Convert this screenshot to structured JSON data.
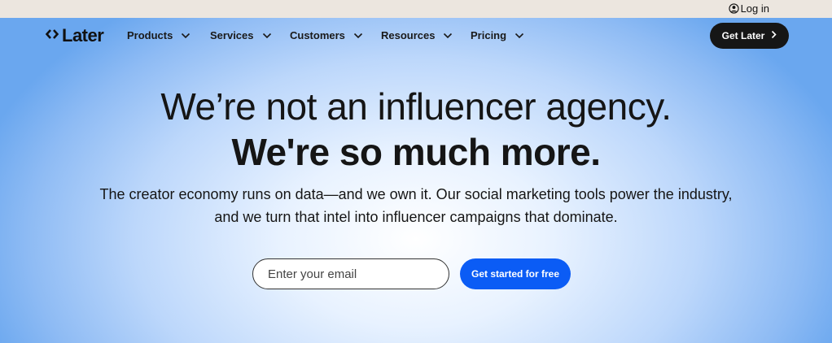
{
  "utility_bar": {
    "login_label": "Log in",
    "login_icon": "user-circle-icon"
  },
  "nav": {
    "logo_text": "Later",
    "logo_icon": "double-chevron-logo-icon",
    "items": [
      {
        "label": "Products"
      },
      {
        "label": "Services"
      },
      {
        "label": "Customers"
      },
      {
        "label": "Resources"
      },
      {
        "label": "Pricing"
      }
    ],
    "cta_label": "Get Later"
  },
  "hero": {
    "headline_line1": "We’re not an influencer agency.",
    "headline_line2": "We're so much more.",
    "subtext": "The creator economy runs on data—and we own it. Our social marketing tools power the industry, and we turn that intel into influencer campaigns that dominate.",
    "email_placeholder": "Enter your email",
    "email_value": "",
    "cta_label": "Get started for free"
  },
  "colors": {
    "primary_blue": "#0b5cf5",
    "dark_button": "#161616",
    "top_bar": "#ece6df",
    "hero_blue": "#6aa7ef"
  }
}
